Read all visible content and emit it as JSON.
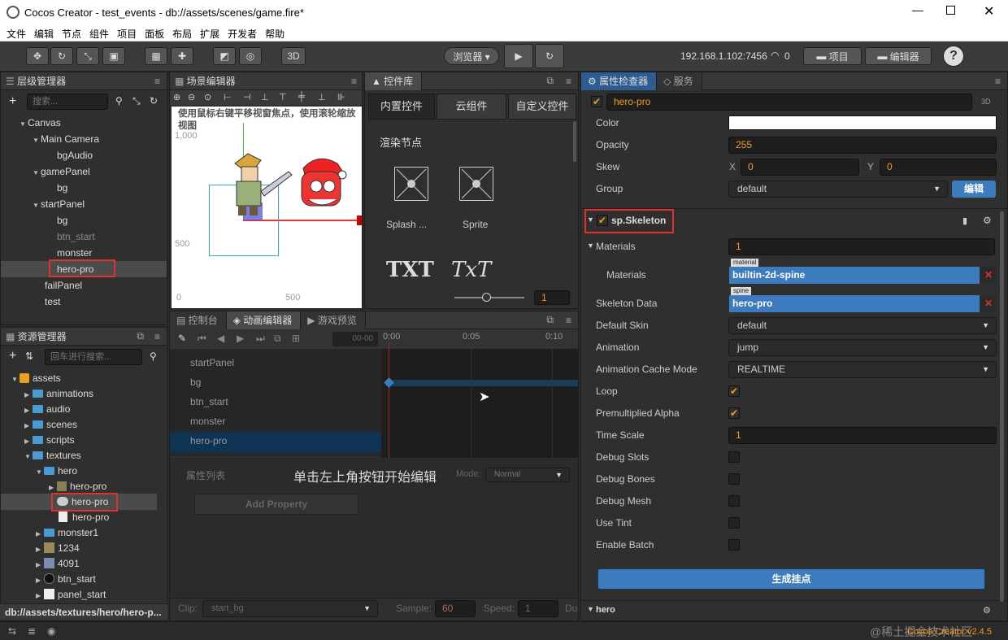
{
  "window": {
    "title": "Cocos Creator - test_events - db://assets/scenes/game.fire*"
  },
  "menu": [
    "文件",
    "编辑",
    "节点",
    "组件",
    "项目",
    "面板",
    "布局",
    "扩展",
    "开发者",
    "帮助"
  ],
  "toolbar": {
    "browser_label": "浏览器 ▾",
    "ip": "192.168.1.102:7456",
    "wifi_count": "0",
    "project_btn": "项目",
    "editor_btn": "编辑器",
    "mode3d": "3D"
  },
  "hierarchy": {
    "title": "层级管理器",
    "search_placeholder": "搜索...",
    "items": [
      "Canvas",
      "Main Camera",
      "bgAudio",
      "gamePanel",
      "bg",
      "startPanel",
      "bg",
      "btn_start",
      "monster",
      "hero-pro",
      "failPanel",
      "test"
    ]
  },
  "scene": {
    "title": "场景编辑器",
    "hint": "使用鼠标右键平移视窗焦点，使用滚轮缩放视图",
    "y1000": "1,000",
    "y500": "500",
    "y0": "0",
    "x500": "500"
  },
  "controls": {
    "title": "控件库",
    "tabs": [
      "内置控件",
      "云组件",
      "自定义控件"
    ],
    "section": "渲染节点",
    "items": [
      "Splash ...",
      "Sprite"
    ],
    "txt1": "TXT",
    "txt2": "TxT",
    "zoom": "1"
  },
  "assets": {
    "title": "资源管理器",
    "search_placeholder": "回车进行搜索...",
    "items": [
      "assets",
      "animations",
      "audio",
      "scenes",
      "scripts",
      "textures",
      "hero",
      "hero-pro",
      "hero-pro",
      "hero-pro",
      "monster1",
      "1234",
      "4091",
      "btn_start",
      "panel_start"
    ],
    "footer_path": "db://assets/textures/hero/hero-p..."
  },
  "bottom_tabs": [
    "控制台",
    "动画编辑器",
    "游戏预览"
  ],
  "animation": {
    "time_input": "00-00",
    "ticks": [
      "0:00",
      "0:05",
      "0:10"
    ],
    "rows": [
      "startPanel",
      "bg",
      "btn_start",
      "monster",
      "hero-pro"
    ],
    "prop_list": "属性列表",
    "mode_label": "Mode:",
    "mode_value": "Normal",
    "add_property": "Add Property",
    "center_hint": "单击左上角按钮开始编辑",
    "clip_label": "Clip:",
    "clip_value": "start_bg",
    "sample_label": "Sample:",
    "sample_value": "60",
    "speed_label": "Speed:",
    "speed_value": "1",
    "dur_label": "Du"
  },
  "inspector": {
    "tab1": "属性检查器",
    "tab2": "服务",
    "node_name": "hero-pro",
    "badge3d": "3D",
    "color_label": "Color",
    "opacity_label": "Opacity",
    "opacity_value": "255",
    "skew_label": "Skew",
    "skew_x_label": "X",
    "skew_x": "0",
    "skew_y_label": "Y",
    "skew_y": "0",
    "group_label": "Group",
    "group_value": "default",
    "group_edit": "编辑",
    "component": "sp.Skeleton",
    "materials_label": "Materials",
    "materials_count": "1",
    "materials_item_label": "Materials",
    "material_tag": "material",
    "material_value": "builtin-2d-spine",
    "skeleton_label": "Skeleton Data",
    "spine_tag": "spine",
    "skeleton_value": "hero-pro",
    "default_skin_label": "Default Skin",
    "default_skin_value": "default",
    "animation_label": "Animation",
    "animation_value": "jump",
    "cache_label": "Animation Cache Mode",
    "cache_value": "REALTIME",
    "loop_label": "Loop",
    "premul_label": "Premultiplied Alpha",
    "timescale_label": "Time Scale",
    "timescale_value": "1",
    "debug_slots": "Debug Slots",
    "debug_bones": "Debug Bones",
    "debug_mesh": "Debug Mesh",
    "use_tint": "Use Tint",
    "enable_batch": "Enable Batch",
    "generate_btn": "生成挂点",
    "next_component": "hero"
  },
  "statusbar": {
    "version": "Cocos Creator v2.4.5",
    "watermark": "@稀土掘金技术社区"
  },
  "colors": {
    "accent": "#f39a1e",
    "select": "#3d7bbf",
    "highlight": "#e03030"
  }
}
